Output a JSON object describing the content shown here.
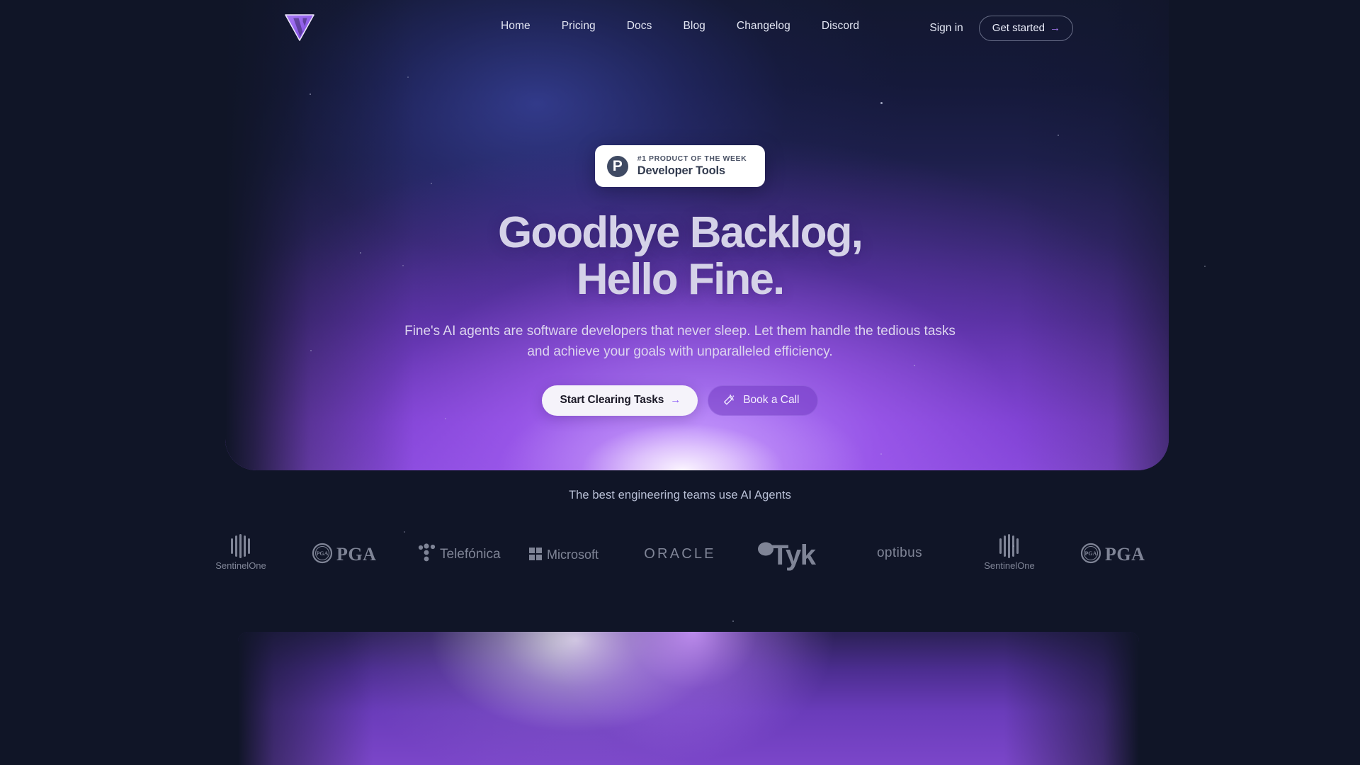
{
  "nav": {
    "logo_alt": "fine-logo",
    "links": [
      {
        "label": "Home"
      },
      {
        "label": "Pricing"
      },
      {
        "label": "Docs"
      },
      {
        "label": "Blog"
      },
      {
        "label": "Changelog"
      },
      {
        "label": "Discord"
      }
    ],
    "sign_in": "Sign in",
    "get_started": "Get started",
    "get_started_arrow": "→"
  },
  "hero": {
    "badge": {
      "avatar_letter": "P",
      "kicker": "#1 PRODUCT OF THE WEEK",
      "title": "Developer Tools"
    },
    "title_line1": "Goodbye Backlog,",
    "title_line2": "Hello Fine.",
    "subtitle": "Fine's AI agents are software developers that never sleep. Let them handle the tedious tasks and achieve your goals with unparalleled efficiency.",
    "primary_cta": "Start Clearing Tasks",
    "primary_cta_arrow": "→",
    "secondary_cta": "Book a Call"
  },
  "logos": {
    "tagline": "The best engineering teams use AI Agents",
    "items": [
      {
        "name": "SentinelOne",
        "kind": "sentinelone"
      },
      {
        "name": "PGA",
        "kind": "pga"
      },
      {
        "name": "Telefónica",
        "kind": "telefonica"
      },
      {
        "name": "Microsoft",
        "kind": "microsoft"
      },
      {
        "name": "ORACLE",
        "kind": "oracle"
      },
      {
        "name": "Tyk",
        "kind": "tyk"
      },
      {
        "name": "optibus",
        "kind": "optibus"
      },
      {
        "name": "SentinelOne",
        "kind": "sentinelone"
      },
      {
        "name": "PGA",
        "kind": "pga"
      }
    ]
  },
  "colors": {
    "page_background": "#101527",
    "accent_purple": "#8b5cf6",
    "logo_purple": "#8b5cf6",
    "hero_glow": "#b98cff",
    "text_primary": "#e4e7f4",
    "text_muted": "#b9c0d6",
    "badge_surface": "#ffffff"
  }
}
